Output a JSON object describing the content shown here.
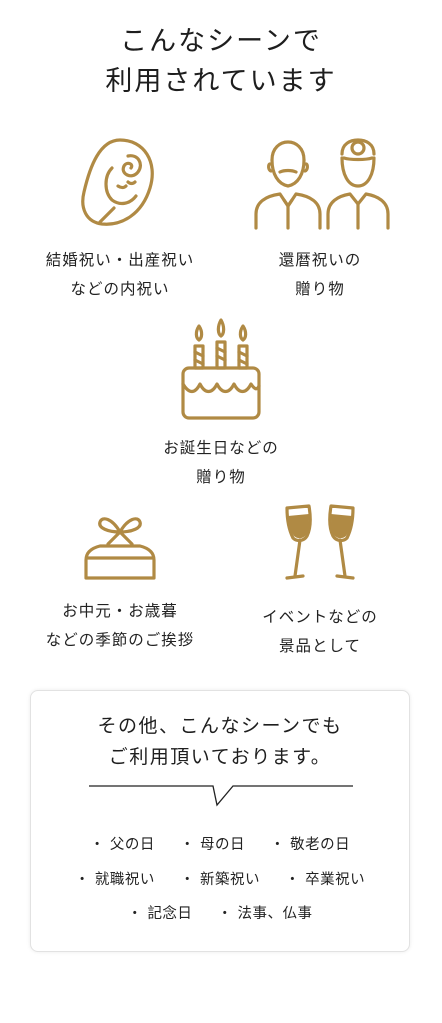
{
  "title": {
    "line1": "こんなシーンで",
    "line2": "利用されています"
  },
  "accent_color": "#b08a44",
  "scenes": [
    {
      "icon": "baby-icon",
      "line1": "結婚祝い・出産祝い",
      "line2": "などの内祝い"
    },
    {
      "icon": "elderly-couple-icon",
      "line1": "還暦祝いの",
      "line2": "贈り物"
    },
    {
      "icon": "birthday-cake-icon",
      "line1": "お誕生日などの",
      "line2": "贈り物"
    },
    {
      "icon": "gift-box-icon",
      "line1": "お中元・お歳暮",
      "line2": "などの季節のご挨拶"
    },
    {
      "icon": "champagne-glasses-icon",
      "line1": "イベントなどの",
      "line2": "景品として"
    }
  ],
  "other": {
    "line1": "その他、こんなシーンでも",
    "line2": "ご利用頂いております。",
    "bullet": "・",
    "rows": [
      [
        "父の日",
        "母の日",
        "敬老の日"
      ],
      [
        "就職祝い",
        "新築祝い",
        "卒業祝い"
      ],
      [
        "記念日",
        "法事、仏事"
      ]
    ]
  }
}
